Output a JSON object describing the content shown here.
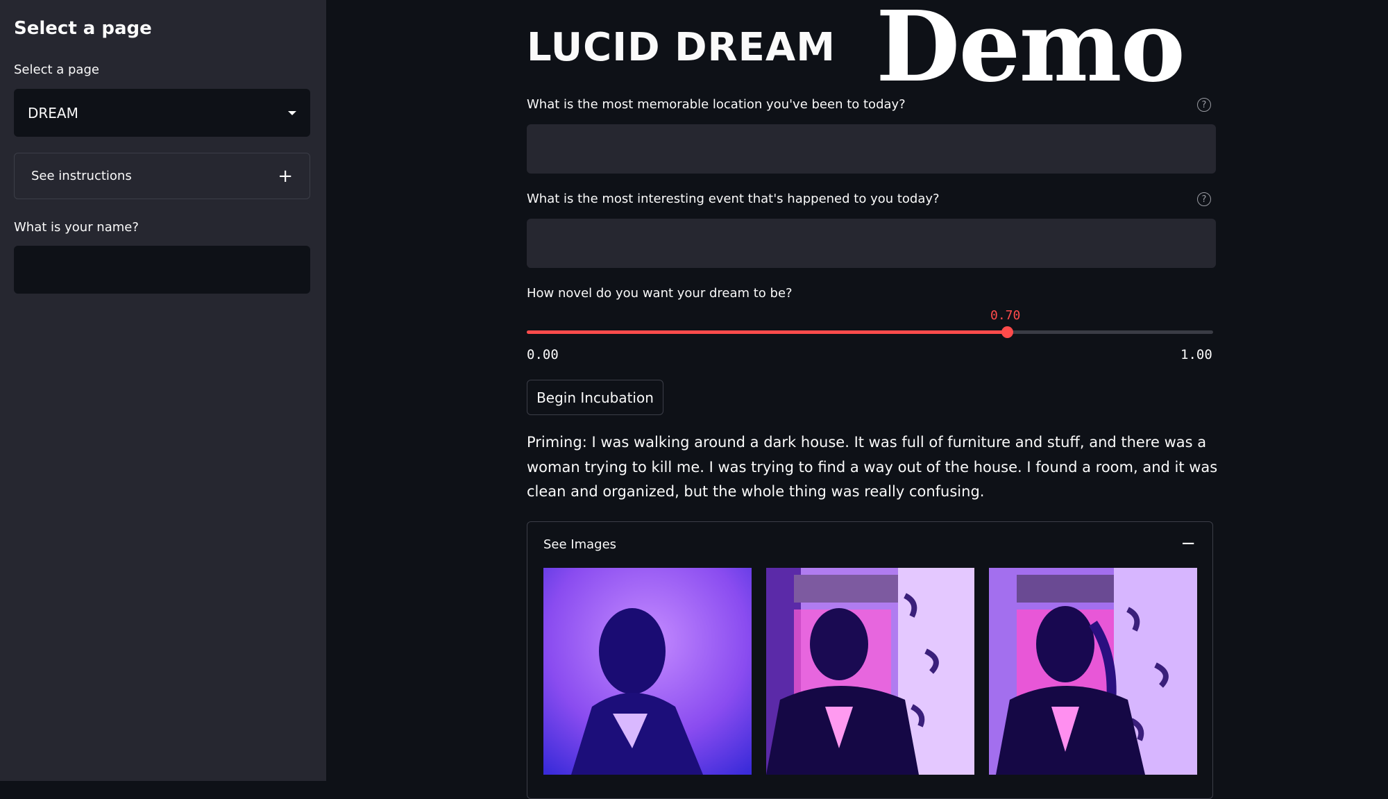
{
  "sidebar": {
    "title": "Select a page",
    "select_label": "Select a page",
    "selected_page": "DREAM",
    "instructions_label": "See instructions",
    "name_label": "What is your name?",
    "name_value": ""
  },
  "main": {
    "title": "LUCID DREAM",
    "overlay_title": "Demo",
    "q_location": "What is the most memorable location you've been to today?",
    "q_location_value": "",
    "q_event": "What is the most interesting event that's happened to you today?",
    "q_event_value": "",
    "slider": {
      "label": "How novel do you want your dream to be?",
      "value": 0.7,
      "value_text": "0.70",
      "min": "0.00",
      "max": "1.00"
    },
    "button_label": "Begin Incubation",
    "priming_text": "Priming: I was walking around a dark house. It was full of furniture and stuff, and there was a woman trying to kill me. I was trying to find a way out of the house. I found a room, and it was clean and organized, but the whole thing was really confusing.",
    "images_expander_label": "See Images"
  },
  "colors": {
    "background": "#0e1117",
    "sidebar": "#262730",
    "accent": "#ff4b4b"
  }
}
